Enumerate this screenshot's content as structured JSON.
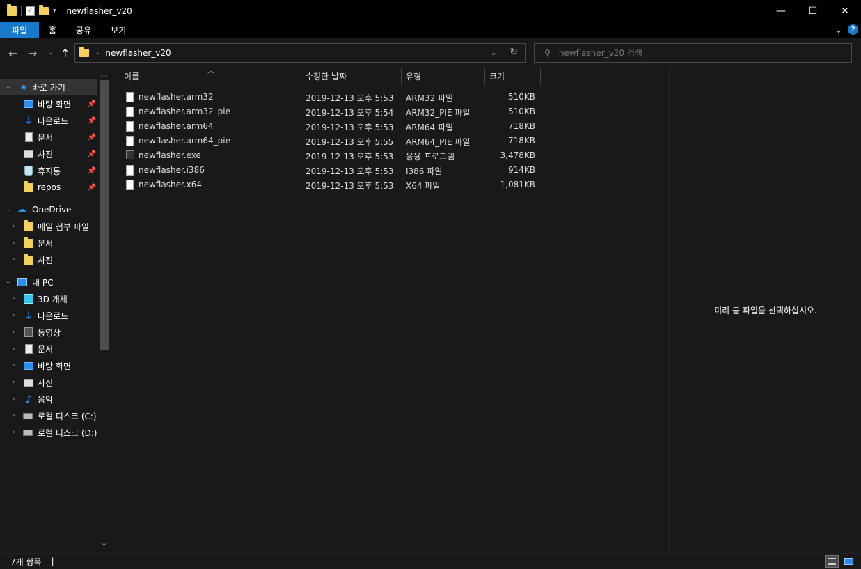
{
  "window": {
    "title": "newflasher_v20",
    "minimize": "—",
    "maximize": "☐",
    "close": "✕"
  },
  "ribbon": {
    "tabs": [
      "파일",
      "홈",
      "공유",
      "보기"
    ]
  },
  "address": {
    "path": "newflasher_v20",
    "search_placeholder": "newflasher_v20 검색"
  },
  "sidebar": {
    "quick_access": "바로 가기",
    "quick_items": [
      "바탕 화면",
      "다운로드",
      "문서",
      "사진",
      "휴지통",
      "repos"
    ],
    "onedrive": "OneDrive",
    "onedrive_items": [
      "메일 첨부 파일",
      "문서",
      "사진"
    ],
    "pc": "내 PC",
    "pc_items": [
      "3D 개체",
      "다운로드",
      "동영상",
      "문서",
      "바탕 화면",
      "사진",
      "음악",
      "로컬 디스크 (C:)",
      "로컬 디스크 (D:)"
    ]
  },
  "columns": {
    "name": "이름",
    "modified": "수정한 날짜",
    "type": "유형",
    "size": "크기"
  },
  "files": [
    {
      "name": "newflasher.arm32",
      "modified": "2019-12-13 오후 5:53",
      "type": "ARM32 파일",
      "size": "510KB"
    },
    {
      "name": "newflasher.arm32_pie",
      "modified": "2019-12-13 오후 5:54",
      "type": "ARM32_PIE 파일",
      "size": "510KB"
    },
    {
      "name": "newflasher.arm64",
      "modified": "2019-12-13 오후 5:53",
      "type": "ARM64 파일",
      "size": "718KB"
    },
    {
      "name": "newflasher.arm64_pie",
      "modified": "2019-12-13 오후 5:55",
      "type": "ARM64_PIE 파일",
      "size": "718KB"
    },
    {
      "name": "newflasher.exe",
      "modified": "2019-12-13 오후 5:53",
      "type": "응용 프로그램",
      "size": "3,478KB"
    },
    {
      "name": "newflasher.i386",
      "modified": "2019-12-13 오후 5:53",
      "type": "I386 파일",
      "size": "914KB"
    },
    {
      "name": "newflasher.x64",
      "modified": "2019-12-13 오후 5:53",
      "type": "X64 파일",
      "size": "1,081KB"
    }
  ],
  "preview": {
    "message": "미리 볼 파일을 선택하십시오."
  },
  "status": {
    "count": "7개 항목",
    "sep": "|"
  },
  "colors": {
    "accent": "#1979ca",
    "background": "#191919",
    "titlebar": "#000000",
    "folder": "#f4d060"
  }
}
